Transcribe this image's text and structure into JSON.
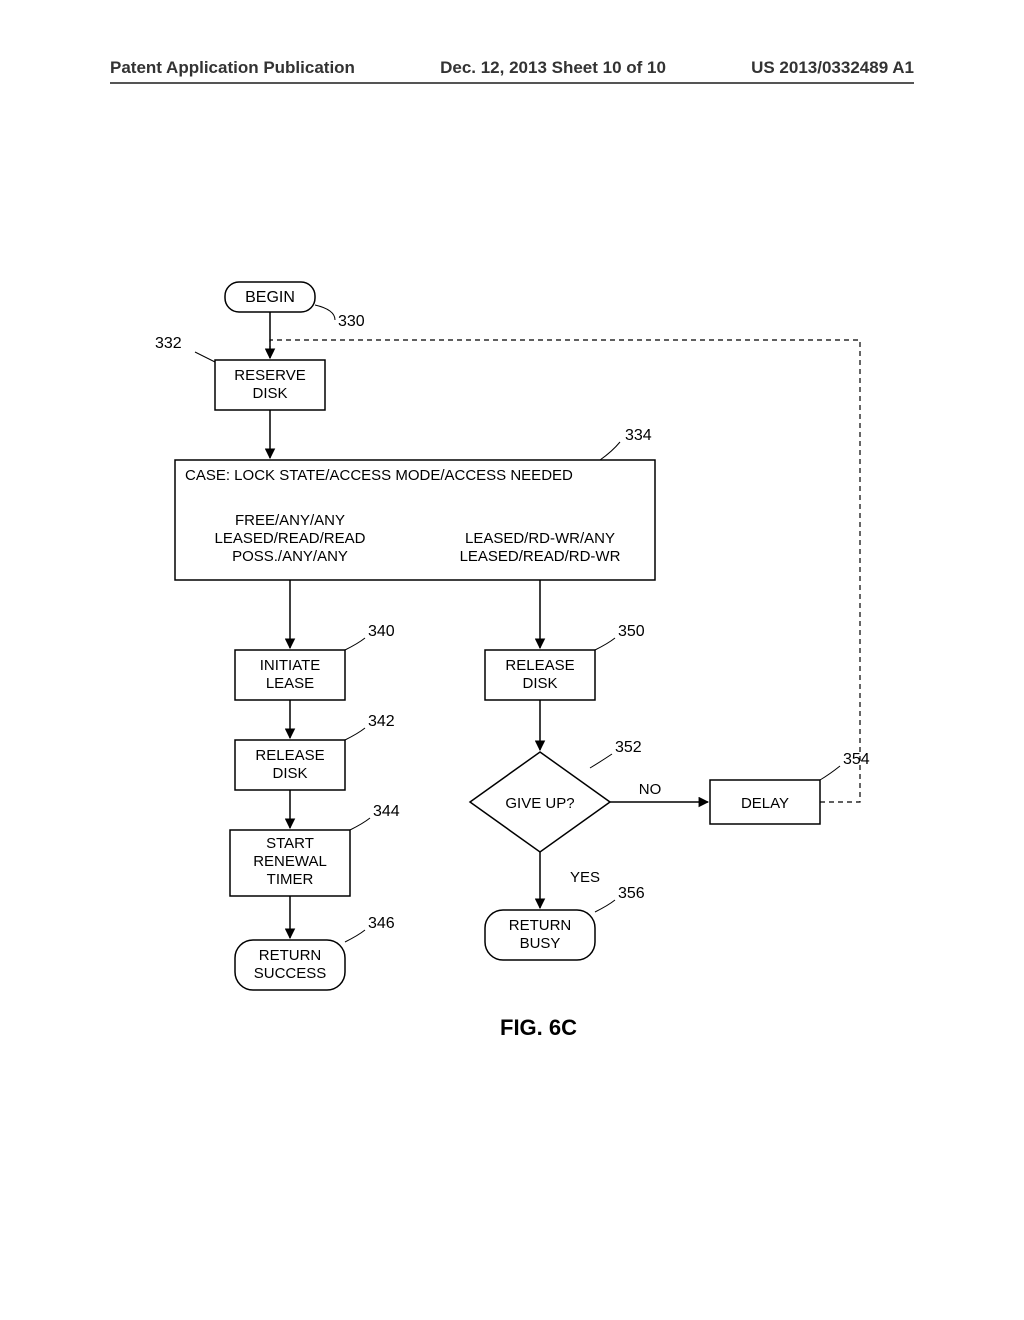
{
  "header": {
    "left": "Patent Application Publication",
    "mid": "Dec. 12, 2013   Sheet 10 of 10",
    "right": "US 2013/0332489 A1"
  },
  "nodes": {
    "begin": "BEGIN",
    "reserve_l1": "RESERVE",
    "reserve_l2": "DISK",
    "case_title": "CASE: LOCK STATE/ACCESS MODE/ACCESS NEEDED",
    "case_left_l1": "FREE/ANY/ANY",
    "case_left_l2": "LEASED/READ/READ",
    "case_left_l3": "POSS./ANY/ANY",
    "case_right_l1": "LEASED/RD-WR/ANY",
    "case_right_l2": "LEASED/READ/RD-WR",
    "initiate_l1": "INITIATE",
    "initiate_l2": "LEASE",
    "release1_l1": "RELEASE",
    "release1_l2": "DISK",
    "start_l1": "START",
    "start_l2": "RENEWAL",
    "start_l3": "TIMER",
    "ret_succ_l1": "RETURN",
    "ret_succ_l2": "SUCCESS",
    "release2_l1": "RELEASE",
    "release2_l2": "DISK",
    "giveup": "GIVE UP?",
    "delay": "DELAY",
    "ret_busy_l1": "RETURN",
    "ret_busy_l2": "BUSY"
  },
  "edges": {
    "no": "NO",
    "yes": "YES"
  },
  "refs": {
    "r330": "330",
    "r332": "332",
    "r334": "334",
    "r340": "340",
    "r342": "342",
    "r344": "344",
    "r346": "346",
    "r350": "350",
    "r352": "352",
    "r354": "354",
    "r356": "356"
  },
  "figure_caption": "FIG. 6C"
}
